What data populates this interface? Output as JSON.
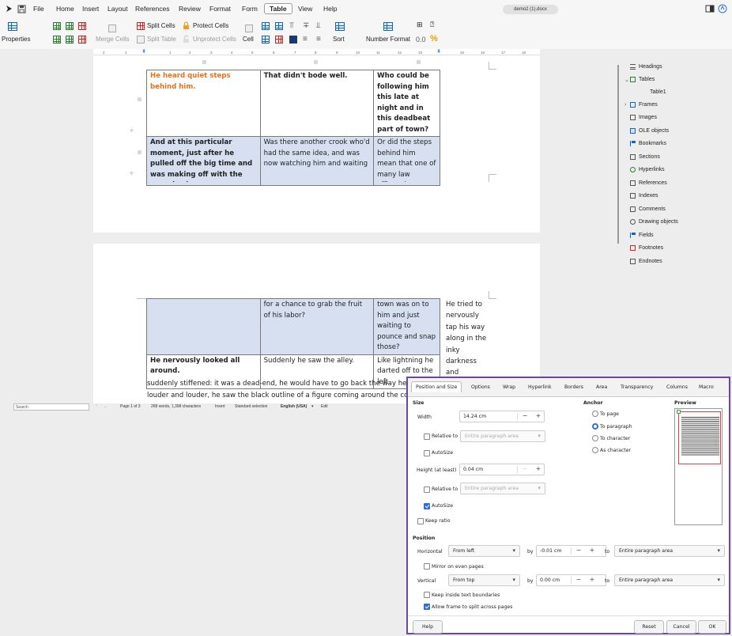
{
  "menubar": {
    "items": [
      "File",
      "Home",
      "Insert",
      "Layout",
      "References",
      "Review",
      "Format",
      "Form",
      "Table",
      "View",
      "Help"
    ],
    "active": "Table",
    "document_name": "demo2 (1).docx"
  },
  "ribbon": {
    "properties": "Properties",
    "merge_cells": "Merge Cells",
    "split_cells": "Split Cells",
    "split_table": "Split Table",
    "protect_cells": "Protect Cells",
    "unprotect_cells": "Unprotect Cells",
    "cell": "Cell",
    "sort": "Sort",
    "number_format": "Number Format",
    "format_symbol_1": "0.0",
    "format_symbol_2": "%"
  },
  "ruler": {
    "ticks": [
      "2",
      "1",
      "1",
      "2",
      "3",
      "4",
      "5",
      "6",
      "7",
      "8",
      "9",
      "10",
      "11",
      "12",
      "13",
      "14",
      "15",
      "16",
      "17",
      "18"
    ]
  },
  "document": {
    "table1": [
      [
        "He heard quiet steps behind him.",
        "That didn't bode well.",
        "Who could be following him this late at night and in this deadbeat part of town?"
      ],
      [
        "And at this particular moment, just after he pulled off the big time and was making off with the greenbacks.",
        "Was there another crook who'd had the same idea, and was now watching him and waiting",
        "Or did the steps behind him mean that one of many law officers in"
      ]
    ],
    "table2": [
      [
        "",
        "for a chance to grab the fruit of his labor?",
        "town was on to him and just waiting to pounce and snap those?"
      ],
      [
        "He nervously looked all around.",
        "Suddenly he saw the alley.",
        "Like lightning he darted off to the left."
      ]
    ],
    "frame_text": [
      "He tried to",
      "nervously",
      "tap his way",
      "along in the",
      "inky",
      "darkness",
      "and"
    ],
    "paragraph": [
      "suddenly stiffened: it was a dead-end, he would have to go back the way he had come.",
      "louder and louder, he saw the black outline of a figure coming around the corner."
    ]
  },
  "statusbar": {
    "search_placeholder": "Search",
    "page": "Page 1 of 3",
    "words": "268 words, 1,398 characters",
    "mode": "Insert",
    "selection": "Standard selection",
    "language": "English (USA)",
    "edit": "Edit"
  },
  "navigator": {
    "items": [
      {
        "label": "Headings",
        "icon": "headings-icon"
      },
      {
        "label": "Tables",
        "icon": "tables-icon",
        "expanded": true
      },
      {
        "label": "Table1",
        "sub": true
      },
      {
        "label": "Frames",
        "icon": "frames-icon",
        "collapsed": true
      },
      {
        "label": "Images",
        "icon": "images-icon"
      },
      {
        "label": "OLE objects",
        "icon": "ole-icon"
      },
      {
        "label": "Bookmarks",
        "icon": "bookmark-icon"
      },
      {
        "label": "Sections",
        "icon": "sections-icon"
      },
      {
        "label": "Hyperlinks",
        "icon": "hyperlinks-icon"
      },
      {
        "label": "References",
        "icon": "references-icon"
      },
      {
        "label": "Indexes",
        "icon": "indexes-icon"
      },
      {
        "label": "Comments",
        "icon": "comments-icon"
      },
      {
        "label": "Drawing objects",
        "icon": "drawing-icon"
      },
      {
        "label": "Fields",
        "icon": "fields-icon"
      },
      {
        "label": "Footnotes",
        "icon": "footnotes-icon"
      },
      {
        "label": "Endnotes",
        "icon": "endnotes-icon"
      }
    ]
  },
  "dialog": {
    "tabs": [
      "Position and Size",
      "Options",
      "Wrap",
      "Hyperlink",
      "Borders",
      "Area",
      "Transparency",
      "Columns",
      "Macro"
    ],
    "active_tab": "Position and Size",
    "size_title": "Size",
    "width_label": "Width",
    "width_value": "14.24 cm",
    "relative_to_label": "Relative to",
    "relative_to_value": "Entire paragraph area",
    "autosize_label": "AutoSize",
    "height_label": "Height (at least)",
    "height_value": "0.04 cm",
    "relative_to_label_2": "Relative to",
    "relative_to_value_2": "Entire paragraph area",
    "autosize_label_2": "AutoSize",
    "keep_ratio_label": "Keep ratio",
    "anchor_title": "Anchor",
    "anchor_options": [
      "To page",
      "To paragraph",
      "To character",
      "As character"
    ],
    "anchor_selected": "To paragraph",
    "preview_title": "Preview",
    "position_title": "Position",
    "horizontal_label": "Horizontal",
    "horizontal_value": "From left",
    "by_label": "by",
    "horizontal_by": "-0.01 cm",
    "to_label": "to",
    "horizontal_to": "Entire paragraph area",
    "mirror_label": "Mirror on even pages",
    "vertical_label": "Vertical",
    "vertical_value": "From top",
    "by_label_2": "by",
    "vertical_by": "0.00 cm",
    "to_label_2": "to",
    "vertical_to": "Entire paragraph area",
    "keep_inside_label": "Keep inside text boundaries",
    "allow_split_label": "Allow frame to split across pages",
    "help": "Help",
    "reset": "Reset",
    "cancel": "Cancel",
    "ok": "OK",
    "minus": "−",
    "plus": "+"
  },
  "colors": {
    "accent": "#2f6fd6",
    "dialog_border": "#6a45a8",
    "selected_cell": "#d6e0f0",
    "orange_text": "#e8711a"
  }
}
